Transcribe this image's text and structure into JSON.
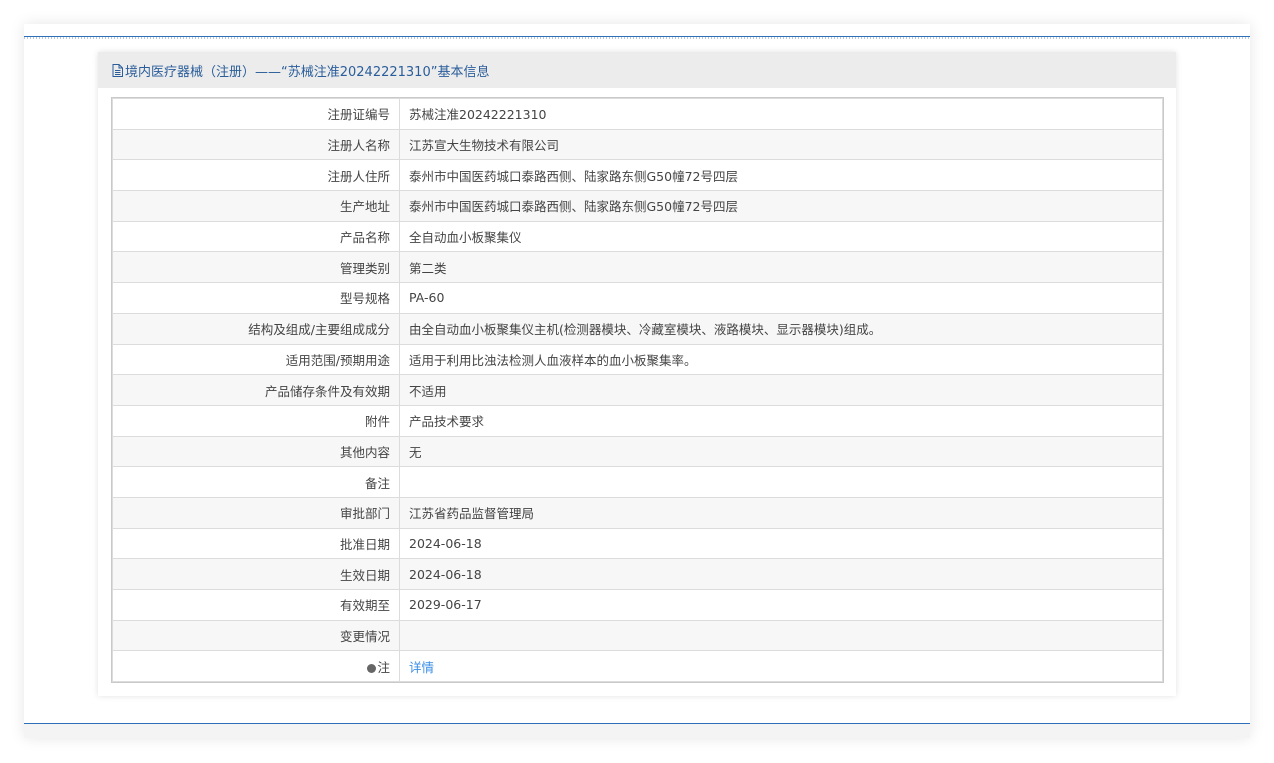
{
  "header": {
    "title": "境内医疗器械（注册）——“苏械注准20242221310”基本信息",
    "icon": "document-icon",
    "title_color": "#2a5d9a"
  },
  "rows": [
    {
      "label": "注册证编号",
      "value": "苏械注准20242221310"
    },
    {
      "label": "注册人名称",
      "value": "江苏宣大生物技术有限公司"
    },
    {
      "label": "注册人住所",
      "value": "泰州市中国医药城口泰路西侧、陆家路东侧G50幢72号四层"
    },
    {
      "label": "生产地址",
      "value": "泰州市中国医药城口泰路西侧、陆家路东侧G50幢72号四层"
    },
    {
      "label": "产品名称",
      "value": "全自动血小板聚集仪"
    },
    {
      "label": "管理类别",
      "value": "第二类"
    },
    {
      "label": "型号规格",
      "value": "PA-60"
    },
    {
      "label": "结构及组成/主要组成成分",
      "value": "由全自动血小板聚集仪主机(检测器模块、冷藏室模块、液路模块、显示器模块)组成。"
    },
    {
      "label": "适用范围/预期用途",
      "value": "适用于利用比浊法检测人血液样本的血小板聚集率。"
    },
    {
      "label": "产品储存条件及有效期",
      "value": "不适用"
    },
    {
      "label": "附件",
      "value": "产品技术要求"
    },
    {
      "label": "其他内容",
      "value": "无"
    },
    {
      "label": "备注",
      "value": ""
    },
    {
      "label": "审批部门",
      "value": "江苏省药品监督管理局"
    },
    {
      "label": "批准日期",
      "value": "2024-06-18"
    },
    {
      "label": "生效日期",
      "value": "2024-06-18"
    },
    {
      "label": "有效期至",
      "value": "2029-06-17"
    },
    {
      "label": "变更情况",
      "value": ""
    }
  ],
  "note": {
    "label": "注",
    "icon": "pin-icon",
    "link": "详情",
    "link_color": "#3a8ee6"
  }
}
